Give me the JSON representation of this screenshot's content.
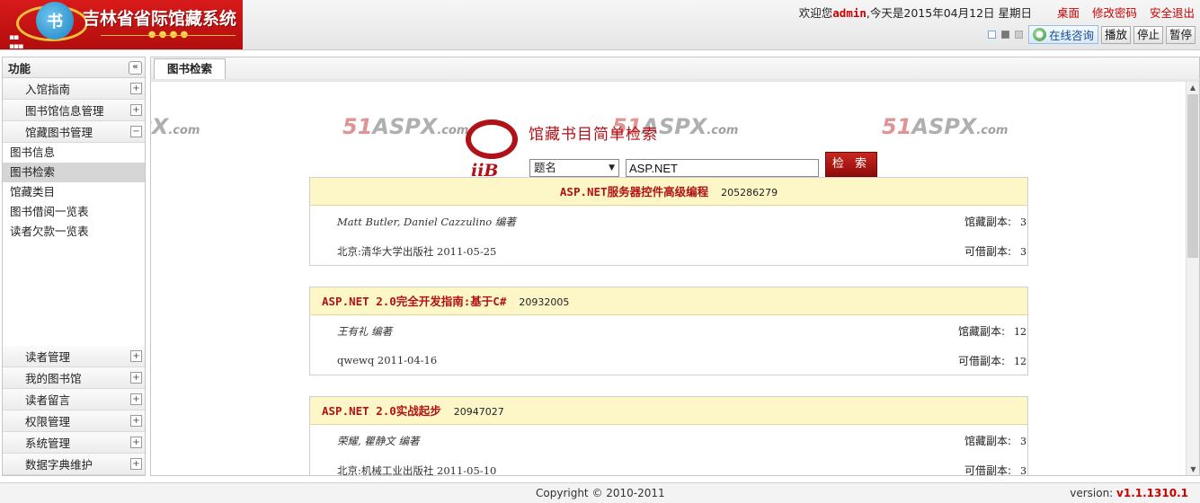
{
  "header": {
    "logo_title": "吉林省省际馆藏系统",
    "logo_mark": "书",
    "welcome_prefix": "欢迎您",
    "username": "admin",
    "date_text": ",今天是2015年04月12日 星期日",
    "links": [
      "桌面",
      "修改密码",
      "安全退出"
    ],
    "online_consult": "在线咨询",
    "play": "播放",
    "stop": "停止",
    "pause": "暂停"
  },
  "sidebar": {
    "title": "功能",
    "top_sections": [
      "入馆指南",
      "图书馆信息管理",
      "馆藏图书管理"
    ],
    "sub_items": [
      "图书信息",
      "图书检索",
      "馆藏类目",
      "图书借阅一览表",
      "读者欠款一览表"
    ],
    "active_sub": "图书检索",
    "bottom_sections": [
      "读者管理",
      "我的图书馆",
      "读者留言",
      "权限管理",
      "系统管理",
      "数据字典维护"
    ]
  },
  "tab": {
    "label": "图书检索"
  },
  "search": {
    "title": "馆藏书目简单检索",
    "logo_text": "iiB",
    "field_selected": "题名",
    "keyword": "ASP.NET",
    "button": "检 索",
    "watermark_prefix": "51",
    "watermark_main": "ASPX",
    "watermark_suffix": ".com"
  },
  "books": [
    {
      "title": "ASP.NET服务器控件高级编程",
      "id": "205286279",
      "authors": "Matt Butler, Daniel Cazzulino  编著",
      "publisher": "北京:清华大学出版社 2011-05-25",
      "holdings_label": "馆藏副本:",
      "holdings": "3",
      "available_label": "可借副本:",
      "available": "3"
    },
    {
      "title": "ASP.NET 2.0完全开发指南:基于C#",
      "id": "20932005",
      "authors": "王有礼  编著",
      "publisher": "qwewq 2011-04-16",
      "holdings_label": "馆藏副本:",
      "holdings": "12",
      "available_label": "可借副本:",
      "available": "12"
    },
    {
      "title": "ASP.NET 2.0实战起步",
      "id": "20947027",
      "authors": "荣耀, 瞿静文  编著",
      "publisher": "北京:机械工业出版社 2011-05-10",
      "holdings_label": "馆藏副本:",
      "holdings": "3",
      "available_label": "可借副本:",
      "available": "3"
    }
  ],
  "footer": {
    "copyright": "Copyright © 2010-2011",
    "version_label": "version:",
    "version": "v1.1.1310.1"
  }
}
